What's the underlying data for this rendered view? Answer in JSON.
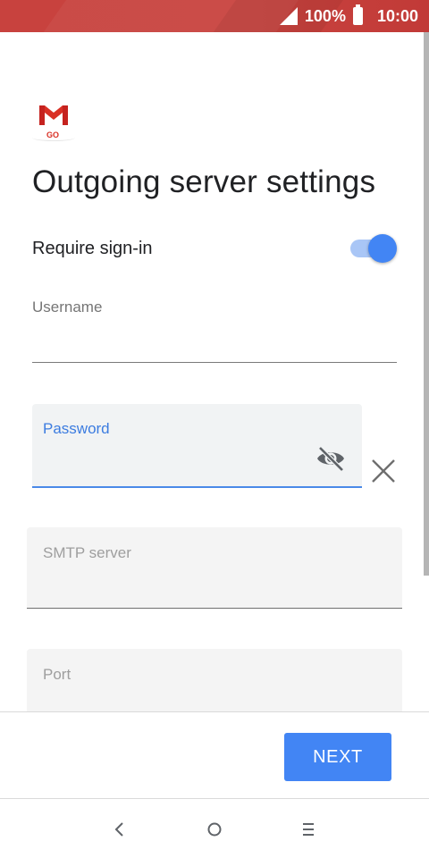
{
  "status_bar": {
    "battery_percent": "100%",
    "time": "10:00",
    "icons": [
      "signal-icon",
      "battery-icon"
    ]
  },
  "app": {
    "logo_text": "GO",
    "brand_color": "#d93025"
  },
  "page": {
    "title": "Outgoing server settings"
  },
  "require_signin": {
    "label": "Require sign-in",
    "enabled": true,
    "accent": "#4285f4"
  },
  "fields": {
    "username": {
      "label": "Username",
      "value": ""
    },
    "password": {
      "label": "Password",
      "value": "",
      "icons": [
        "eye-off-icon",
        "close-icon"
      ]
    },
    "smtp_server": {
      "label": "SMTP server",
      "value": ""
    },
    "port": {
      "label": "Port",
      "value": ""
    }
  },
  "actions": {
    "next_label": "NEXT"
  },
  "nav": {
    "buttons": [
      "back-icon",
      "home-icon",
      "recents-icon"
    ]
  }
}
